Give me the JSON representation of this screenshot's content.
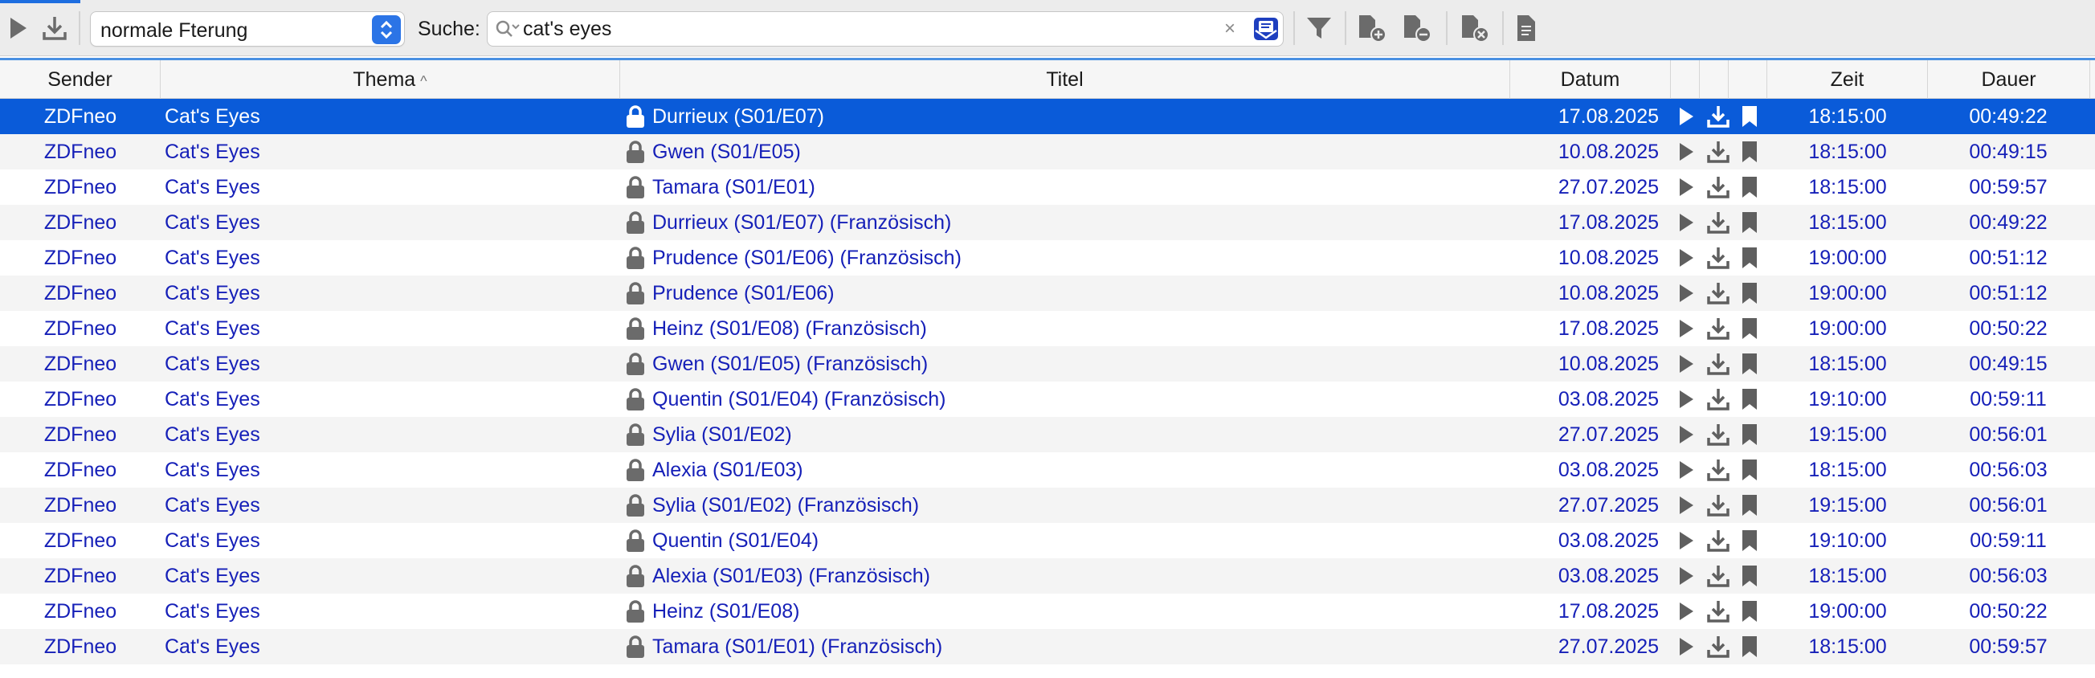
{
  "toolbar": {
    "filter_select_value": "normale Fterung",
    "search_label": "Suche:",
    "search_value": "cat's eyes",
    "clear_glyph": "×",
    "icons": [
      "play-icon",
      "download-icon",
      "filter-icon",
      "add-file-icon",
      "remove-file-icon",
      "delete-file-icon",
      "document-icon"
    ]
  },
  "columns": {
    "sender": "Sender",
    "thema": "Thema",
    "thema_sort": "^",
    "titel": "Titel",
    "datum": "Datum",
    "zeit": "Zeit",
    "dauer": "Dauer"
  },
  "colors": {
    "selection": "#0a5bd9",
    "link_text": "#1620b8",
    "accent": "#2b74e6"
  },
  "rows": [
    {
      "sender": "ZDFneo",
      "thema": "Cat's Eyes",
      "titel": "Durrieux (S01/E07)",
      "datum": "17.08.2025",
      "zeit": "18:15:00",
      "dauer": "00:49:22",
      "selected": true
    },
    {
      "sender": "ZDFneo",
      "thema": "Cat's Eyes",
      "titel": "Gwen (S01/E05)",
      "datum": "10.08.2025",
      "zeit": "18:15:00",
      "dauer": "00:49:15"
    },
    {
      "sender": "ZDFneo",
      "thema": "Cat's Eyes",
      "titel": "Tamara (S01/E01)",
      "datum": "27.07.2025",
      "zeit": "18:15:00",
      "dauer": "00:59:57"
    },
    {
      "sender": "ZDFneo",
      "thema": "Cat's Eyes",
      "titel": "Durrieux (S01/E07) (Französisch)",
      "datum": "17.08.2025",
      "zeit": "18:15:00",
      "dauer": "00:49:22"
    },
    {
      "sender": "ZDFneo",
      "thema": "Cat's Eyes",
      "titel": "Prudence (S01/E06) (Französisch)",
      "datum": "10.08.2025",
      "zeit": "19:00:00",
      "dauer": "00:51:12"
    },
    {
      "sender": "ZDFneo",
      "thema": "Cat's Eyes",
      "titel": "Prudence (S01/E06)",
      "datum": "10.08.2025",
      "zeit": "19:00:00",
      "dauer": "00:51:12"
    },
    {
      "sender": "ZDFneo",
      "thema": "Cat's Eyes",
      "titel": "Heinz (S01/E08) (Französisch)",
      "datum": "17.08.2025",
      "zeit": "19:00:00",
      "dauer": "00:50:22"
    },
    {
      "sender": "ZDFneo",
      "thema": "Cat's Eyes",
      "titel": "Gwen (S01/E05) (Französisch)",
      "datum": "10.08.2025",
      "zeit": "18:15:00",
      "dauer": "00:49:15"
    },
    {
      "sender": "ZDFneo",
      "thema": "Cat's Eyes",
      "titel": "Quentin (S01/E04) (Französisch)",
      "datum": "03.08.2025",
      "zeit": "19:10:00",
      "dauer": "00:59:11"
    },
    {
      "sender": "ZDFneo",
      "thema": "Cat's Eyes",
      "titel": "Sylia (S01/E02)",
      "datum": "27.07.2025",
      "zeit": "19:15:00",
      "dauer": "00:56:01"
    },
    {
      "sender": "ZDFneo",
      "thema": "Cat's Eyes",
      "titel": "Alexia (S01/E03)",
      "datum": "03.08.2025",
      "zeit": "18:15:00",
      "dauer": "00:56:03"
    },
    {
      "sender": "ZDFneo",
      "thema": "Cat's Eyes",
      "titel": "Sylia (S01/E02) (Französisch)",
      "datum": "27.07.2025",
      "zeit": "19:15:00",
      "dauer": "00:56:01"
    },
    {
      "sender": "ZDFneo",
      "thema": "Cat's Eyes",
      "titel": "Quentin (S01/E04)",
      "datum": "03.08.2025",
      "zeit": "19:10:00",
      "dauer": "00:59:11"
    },
    {
      "sender": "ZDFneo",
      "thema": "Cat's Eyes",
      "titel": "Alexia (S01/E03) (Französisch)",
      "datum": "03.08.2025",
      "zeit": "18:15:00",
      "dauer": "00:56:03"
    },
    {
      "sender": "ZDFneo",
      "thema": "Cat's Eyes",
      "titel": "Heinz (S01/E08)",
      "datum": "17.08.2025",
      "zeit": "19:00:00",
      "dauer": "00:50:22"
    },
    {
      "sender": "ZDFneo",
      "thema": "Cat's Eyes",
      "titel": "Tamara (S01/E01) (Französisch)",
      "datum": "27.07.2025",
      "zeit": "18:15:00",
      "dauer": "00:59:57"
    }
  ]
}
